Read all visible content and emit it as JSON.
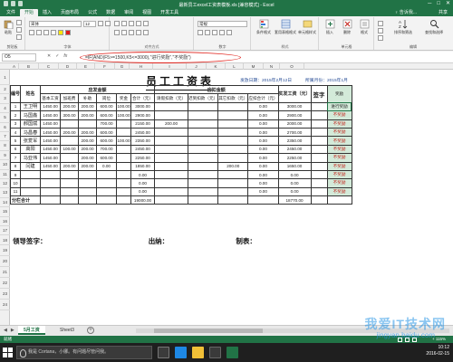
{
  "window": {
    "title": "最新员工excel工资表模板.xls [兼容模式] - Excel",
    "controls": [
      "─",
      "□",
      "✕"
    ]
  },
  "ribbon": {
    "tabs": [
      "文件",
      "开始",
      "插入",
      "页面布局",
      "公式",
      "数据",
      "审阅",
      "视图",
      "开发工具"
    ],
    "active_tab": "开始",
    "tell_me": "♀ 告诉我...",
    "share": "共享",
    "font_name": "宋体",
    "font_size": "12",
    "number_format": "常规",
    "buttons": {
      "paste": "粘贴",
      "conditional": "条件格式",
      "table_format": "套用表格格式",
      "cell_style": "单元格样式",
      "insert": "插入",
      "delete": "删除",
      "format": "格式",
      "sort": "排序和筛选",
      "find": "查找和选择"
    },
    "groups": {
      "clipboard": "剪贴板",
      "font": "字体",
      "alignment": "对齐方式",
      "number": "数字",
      "styles": "样式",
      "cells": "单元格",
      "editing": "编辑"
    }
  },
  "formula_bar": {
    "name_box": "O5",
    "formula": "=IF(AND(F5>=1500,K5<=3000),\"进行奖励\",\"不奖励\")"
  },
  "grid": {
    "columns": [
      "A",
      "B",
      "C",
      "D",
      "E",
      "F",
      "G",
      "H",
      "I",
      "J",
      "K",
      "L",
      "M",
      "N",
      "O"
    ],
    "rows": [
      "1",
      "2",
      "3",
      "4",
      "5",
      "6",
      "7",
      "8",
      "9",
      "10",
      "11",
      "12",
      "13",
      "14",
      "15",
      "16",
      "17",
      "18",
      "19",
      "20",
      "21",
      "22",
      "23",
      "24"
    ]
  },
  "document": {
    "title": "员工工资表",
    "date_label": "发放日期：2015年2月12日",
    "period_label": "所属月份：2015年1月",
    "headers": {
      "number": "编号",
      "name": "姓名",
      "should_pay": "应发金额",
      "deduct": "应扣金额",
      "base": "基本工资",
      "overtime": "加班费",
      "subsidy": "补助",
      "bonus_pos": "岗位",
      "award": "奖金",
      "total": "合计（元）",
      "leave": "请假扣款（元）",
      "late": "迟到扣款（元）",
      "other": "其它扣款（元）",
      "deduct_total": "应扣合计（元）",
      "net": "实发工资（元）",
      "sign": "签字",
      "reward": "奖励"
    },
    "rows": [
      {
        "no": "1",
        "name": "王卫明",
        "base": "1450.00",
        "ot": "200.00",
        "sub": "200.00",
        "pos": "600.00",
        "award": "100.00",
        "total": "3000.00",
        "leave": "",
        "late": "",
        "other": "",
        "ded": "0.00",
        "net": "3000.00",
        "reward": "进行奖励"
      },
      {
        "no": "2",
        "name": "马国鑫",
        "base": "1450.00",
        "ot": "300.00",
        "sub": "200.00",
        "pos": "600.00",
        "award": "100.00",
        "total": "2900.00",
        "leave": "",
        "late": "",
        "other": "",
        "ded": "0.00",
        "net": "2900.00",
        "reward": "不奖励"
      },
      {
        "no": "3",
        "name": "郝国斌",
        "base": "1450.00",
        "ot": "",
        "sub": "",
        "pos": "700.00",
        "award": "",
        "total": "2150.00",
        "leave": "200.00",
        "late": "",
        "other": "",
        "ded": "0.00",
        "net": "2000.00",
        "reward": "不奖励"
      },
      {
        "no": "4",
        "name": "马昌春",
        "base": "1450.00",
        "ot": "200.00",
        "sub": "200.00",
        "pos": "600.00",
        "award": "",
        "total": "2450.00",
        "leave": "",
        "late": "",
        "other": "",
        "ded": "0.00",
        "net": "2700.00",
        "reward": "不奖励"
      },
      {
        "no": "5",
        "name": "张爱军",
        "base": "1450.00",
        "ot": "",
        "sub": "200.00",
        "pos": "600.00",
        "award": "100.00",
        "total": "2350.00",
        "leave": "",
        "late": "",
        "other": "",
        "ded": "0.00",
        "net": "2350.00",
        "reward": "不奖励"
      },
      {
        "no": "6",
        "name": "高阳",
        "base": "1450.00",
        "ot": "100.00",
        "sub": "200.00",
        "pos": "700.00",
        "award": "",
        "total": "2450.00",
        "leave": "",
        "late": "",
        "other": "",
        "ded": "0.00",
        "net": "2450.00",
        "reward": "不奖励"
      },
      {
        "no": "7",
        "name": "马亚伟",
        "base": "1450.00",
        "ot": "",
        "sub": "200.00",
        "pos": "600.00",
        "award": "",
        "total": "2250.00",
        "leave": "",
        "late": "",
        "other": "",
        "ded": "0.00",
        "net": "2250.00",
        "reward": "不奖励"
      },
      {
        "no": "8",
        "name": "闫建",
        "base": "1450.00",
        "ot": "200.00",
        "sub": "200.00",
        "pos": "0.00",
        "award": "",
        "total": "1850.00",
        "leave": "",
        "late": "",
        "other": "200.00",
        "ded": "0.00",
        "net": "1650.00",
        "reward": "不奖励"
      },
      {
        "no": "9",
        "name": "",
        "base": "",
        "ot": "",
        "sub": "",
        "pos": "",
        "award": "",
        "total": "0.00",
        "leave": "",
        "late": "",
        "other": "",
        "ded": "0.00",
        "net": "0.00",
        "reward": "不奖励"
      },
      {
        "no": "10",
        "name": "",
        "base": "",
        "ot": "",
        "sub": "",
        "pos": "",
        "award": "",
        "total": "0.00",
        "leave": "",
        "late": "",
        "other": "",
        "ded": "0.00",
        "net": "0.00",
        "reward": "不奖励"
      },
      {
        "no": "11",
        "name": "",
        "base": "",
        "ot": "",
        "sub": "",
        "pos": "",
        "award": "",
        "total": "0.00",
        "leave": "",
        "late": "",
        "other": "",
        "ded": "0.00",
        "net": "0.00",
        "reward": "不奖励"
      }
    ],
    "subtotal_label": "分栏合计",
    "subtotal_total": "19000.00",
    "subtotal_net": "18770.00",
    "sign_leader": "领导签字：",
    "sign_cashier": "出纳：",
    "sign_maker": "制表："
  },
  "sheet_tabs": {
    "nav": [
      "◀",
      "▶"
    ],
    "tabs": [
      "5月工资",
      "Sheet3"
    ],
    "active": "5月工资",
    "add": "+"
  },
  "status": {
    "ready": "就绪",
    "zoom": "+ 115%"
  },
  "taskbar": {
    "search_placeholder": "我是 Cortana，小娜。有问题尽管问我。",
    "time": "10:12",
    "date": "2016-02-15"
  },
  "watermark": {
    "brand": "我爱IT技术网",
    "url": "jingyan.baidu.com"
  },
  "colors": {
    "excel_green": "#217346",
    "reward_cell": "#d3ead9",
    "reward_red": "#c21f16",
    "highlight_oval": "#e0231c"
  }
}
